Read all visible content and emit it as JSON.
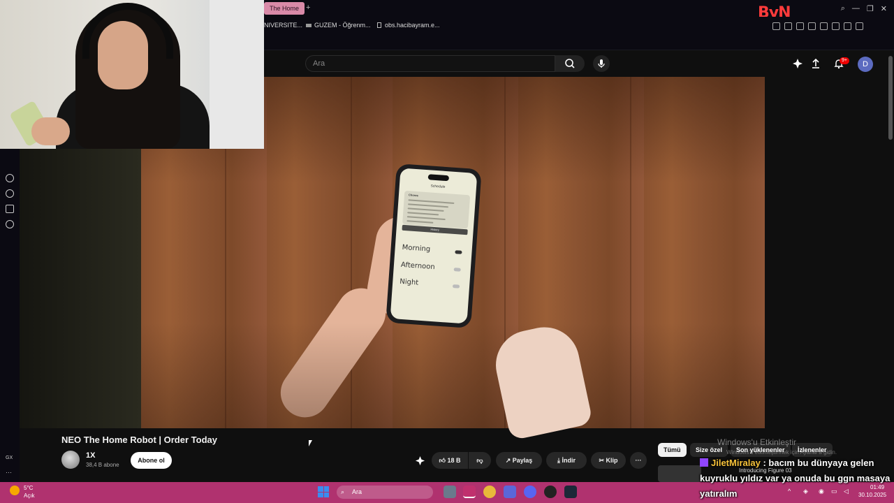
{
  "browser": {
    "tab_title": "The Home",
    "bookmarks": [
      "NIVERSITE...",
      "GUZEM - Öğrenm...",
      "obs.hacibayram.e..."
    ],
    "brand_logo": "ByN",
    "side_badge": "GX"
  },
  "header": {
    "search_placeholder": "Ara",
    "notification_count": "9+",
    "avatar_letter": "D"
  },
  "video": {
    "phone_title": "Schedule",
    "phone_card_heading": "Chores",
    "phone_button": "History",
    "phone_rows": [
      "Morning",
      "Afternoon",
      "Night"
    ]
  },
  "meta": {
    "title": "NEO The Home Robot | Order Today",
    "channel_name": "1X",
    "subscribers": "38,4 B abone",
    "subscribe_label": "Abone ol",
    "likes": "18 B",
    "share_label": "Paylaş",
    "download_label": "İndir",
    "clip_label": "Klip"
  },
  "chips": [
    "Tümü",
    "Size özel",
    "Son yüklenenler",
    "İzlenenler"
  ],
  "watermark": {
    "line1": "Windows'u Etkinleştir",
    "line2": "Windows'u etkinleştirmek için Ayarlar'a gidin."
  },
  "suggestion_label": "Introducing Figure 03",
  "chat": {
    "user": "JiletMiralay",
    "message": ": bacım bu dünyaya gelen kuyruklu yıldız var ya onuda bu ggn masaya yatıralım"
  },
  "taskbar": {
    "temperature": "5°C",
    "condition": "Açık",
    "search_label": "Ara",
    "time": "01:49",
    "date": "30.10.2025"
  }
}
